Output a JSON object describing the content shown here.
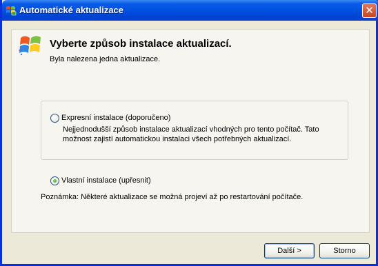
{
  "window": {
    "title": "Automatické aktualizace",
    "close_glyph": "✕",
    "title_icon": "windows-update-icon"
  },
  "content": {
    "heading": "Vyberte způsob instalace aktualizací.",
    "subheading": "Byla nalezena jedna aktualizace.",
    "logo_icon": "windows-logo-icon"
  },
  "options": [
    {
      "label": "Expresní instalace (doporučeno)",
      "description_line1": "Nejjednodušší způsob instalace aktualizací vhodných pro tento počítač. Tato",
      "description_line2": "možnost zajistí automatickou instalaci všech potřebných aktualizací.",
      "selected": false
    },
    {
      "label": "Vlastní instalace (upřesnit)",
      "selected": true
    }
  ],
  "note": "Poznámka:  Některé aktualizace se možná projeví až po restartování počítače.",
  "buttons": {
    "next": "Další >",
    "cancel": "Storno"
  },
  "colors": {
    "titlebar": "#0054e3",
    "window_bg": "#ece9d8",
    "panel_bg": "#f6f5ef",
    "close_button": "#c8451f"
  }
}
